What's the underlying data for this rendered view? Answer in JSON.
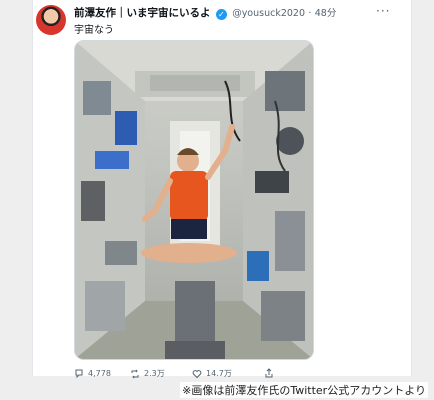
{
  "tweet": {
    "display_name": "前澤友作｜いま宇宙にいるよ",
    "handle": "@yousuck2020",
    "separator": "·",
    "time": "48分",
    "text": "宇宙なう"
  },
  "actions": {
    "reply_count": "4,778",
    "retweet_count": "2.3万",
    "like_count": "14.7万"
  },
  "caption": "※画像は前澤友作氏のTwitter公式アカウントより",
  "colors": {
    "verified": "#1d9bf0",
    "secondary_text": "#536471",
    "shirt": "#e8561f"
  }
}
